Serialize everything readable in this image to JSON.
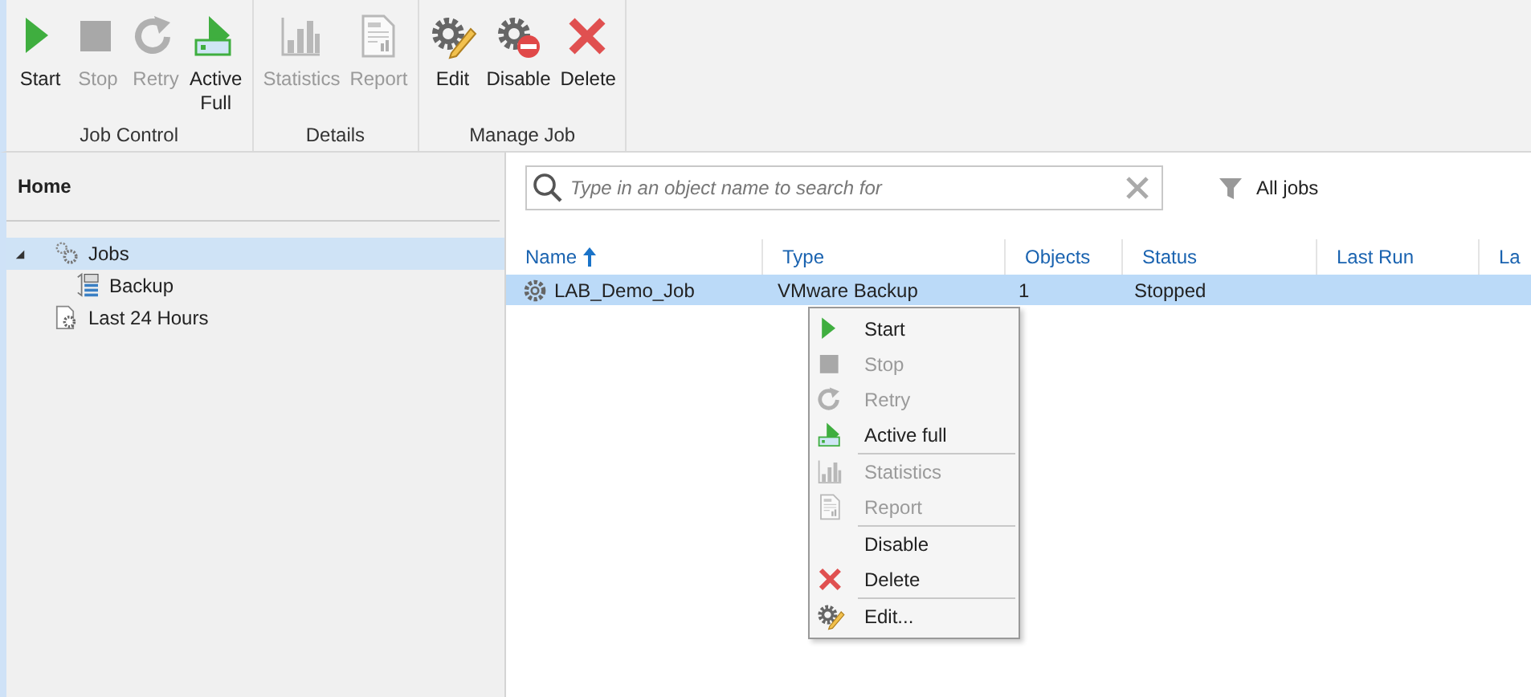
{
  "ribbon": {
    "groups": [
      {
        "label": "Job Control",
        "buttons": [
          {
            "label": "Start",
            "kind": "play",
            "disabled": false
          },
          {
            "label": "Stop",
            "kind": "stop",
            "disabled": true
          },
          {
            "label": "Retry",
            "kind": "retry",
            "disabled": true
          },
          {
            "label": "Active\nFull",
            "kind": "activefull",
            "disabled": false
          }
        ]
      },
      {
        "label": "Details",
        "buttons": [
          {
            "label": "Statistics",
            "kind": "stats",
            "disabled": true
          },
          {
            "label": "Report",
            "kind": "report",
            "disabled": true
          }
        ]
      },
      {
        "label": "Manage Job",
        "buttons": [
          {
            "label": "Edit",
            "kind": "edit",
            "disabled": false
          },
          {
            "label": "Disable",
            "kind": "disable",
            "disabled": false
          },
          {
            "label": "Delete",
            "kind": "delete",
            "disabled": false
          }
        ]
      }
    ]
  },
  "sidebar": {
    "title": "Home",
    "tree": [
      {
        "label": "Jobs",
        "kind": "gears",
        "expanded": true,
        "selected": true,
        "children": [
          {
            "label": "Backup",
            "kind": "backup",
            "selected": false
          }
        ]
      },
      {
        "label": "Last 24 Hours",
        "kind": "doc",
        "selected": false
      }
    ]
  },
  "search": {
    "placeholder": "Type in an object name to search for"
  },
  "filter": {
    "label": "All jobs"
  },
  "table": {
    "columns": [
      {
        "label": "Name",
        "sorted": true
      },
      {
        "label": "Type",
        "sorted": false
      },
      {
        "label": "Objects",
        "sorted": false
      },
      {
        "label": "Status",
        "sorted": false
      },
      {
        "label": "Last Run",
        "sorted": false
      },
      {
        "label": "La",
        "sorted": false
      }
    ],
    "rows": [
      {
        "selected": true,
        "cells": [
          "LAB_Demo_Job",
          "VMware Backup",
          "1",
          "Stopped"
        ]
      }
    ]
  },
  "context_menu": {
    "groups": [
      [
        {
          "label": "Start",
          "kind": "play",
          "disabled": false
        },
        {
          "label": "Stop",
          "kind": "stop",
          "disabled": true
        },
        {
          "label": "Retry",
          "kind": "retry",
          "disabled": true
        },
        {
          "label": "Active full",
          "kind": "activefull",
          "disabled": false
        }
      ],
      [
        {
          "label": "Statistics",
          "kind": "stats",
          "disabled": true
        },
        {
          "label": "Report",
          "kind": "report",
          "disabled": true
        }
      ],
      [
        {
          "label": "Disable",
          "kind": "plain",
          "disabled": false
        },
        {
          "label": "Delete",
          "kind": "delete",
          "disabled": false
        }
      ],
      [
        {
          "label": "Edit...",
          "kind": "edit",
          "disabled": false
        }
      ]
    ]
  }
}
